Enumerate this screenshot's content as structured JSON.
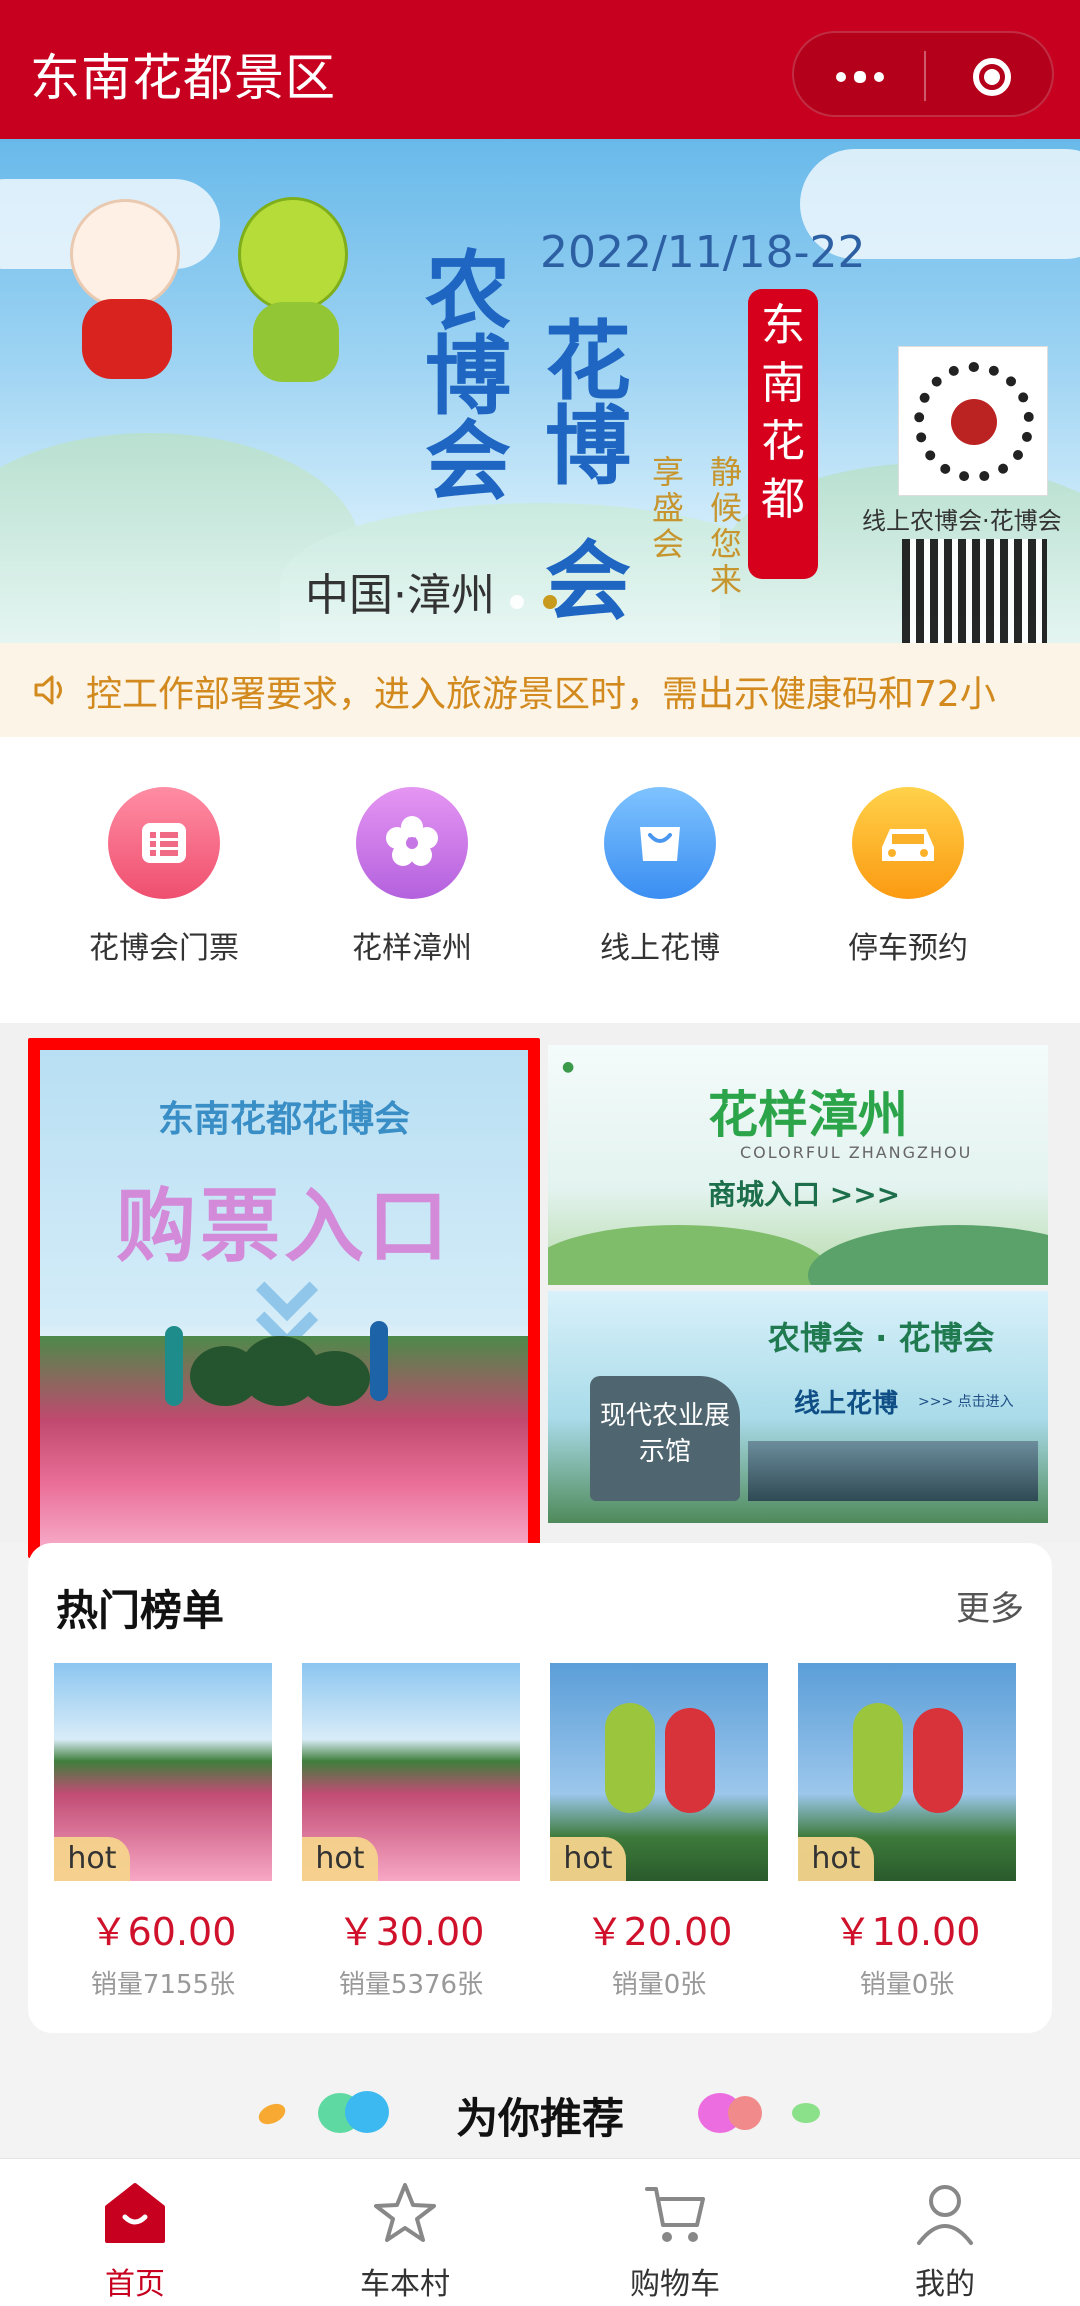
{
  "header": {
    "title": "东南花都景区"
  },
  "banner": {
    "date": "2022/11/18-22",
    "title_chars": [
      "农",
      "博",
      "会",
      "花",
      "博",
      "会"
    ],
    "side_text_1": "享盛会",
    "side_text_2": "静候您来",
    "red_badge": "东南花都",
    "location": "中国·漳州",
    "qr_caption": "线上农博会·花博会"
  },
  "notice": {
    "text": "控工作部署要求，进入旅游景区时，需出示健康码和72小"
  },
  "quick_menu": [
    {
      "label": "花博会门票",
      "icon": "ticket-icon",
      "color_from": "#ff8da4",
      "color_to": "#ef4f6f"
    },
    {
      "label": "花样漳州",
      "icon": "flower-icon",
      "color_from": "#e596f2",
      "color_to": "#b461de"
    },
    {
      "label": "线上花博",
      "icon": "shopping-bag-icon",
      "color_from": "#7fc3ff",
      "color_to": "#3a8ef2"
    },
    {
      "label": "停车预约",
      "icon": "car-icon",
      "color_from": "#ffd24a",
      "color_to": "#fb9a12"
    }
  ],
  "promo": {
    "ticket": {
      "line1": "东南花都花博会",
      "line2": "购票入口"
    },
    "mall": {
      "brand": "花样漳州",
      "sub": "COLORFUL ZHANGZHOU",
      "entry": "商城入口 >>>"
    },
    "online": {
      "heading": "农博会 · 花博会",
      "label": "线上花博",
      "small": ">>> 点击进入",
      "stone": "现代农业展示馆"
    }
  },
  "hot": {
    "title": "热门榜单",
    "more": "更多",
    "items": [
      {
        "tag": "hot",
        "price": "￥60.00",
        "sales": "销量7155张"
      },
      {
        "tag": "hot",
        "price": "￥30.00",
        "sales": "销量5376张"
      },
      {
        "tag": "hot",
        "price": "￥20.00",
        "sales": "销量0张"
      },
      {
        "tag": "hot",
        "price": "￥10.00",
        "sales": "销量0张"
      }
    ]
  },
  "recommend": {
    "title": "为你推荐"
  },
  "tabbar": [
    {
      "label": "首页",
      "icon": "home-icon",
      "active": true
    },
    {
      "label": "车本村",
      "icon": "star-icon",
      "active": false
    },
    {
      "label": "购物车",
      "icon": "cart-icon",
      "active": false
    },
    {
      "label": "我的",
      "icon": "user-icon",
      "active": false
    }
  ],
  "colors": {
    "brand": "#c8001f",
    "price": "#d0112b",
    "notice": "#d28a1e"
  }
}
